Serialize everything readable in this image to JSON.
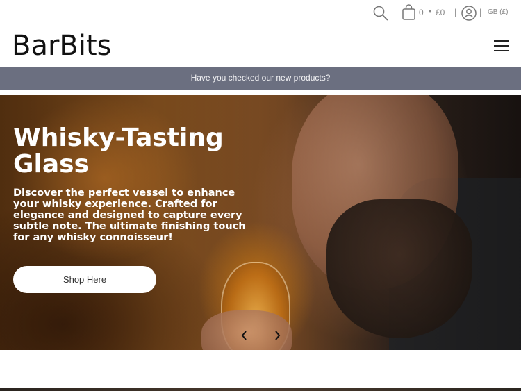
{
  "utility": {
    "cart_count": "0",
    "separator_dot": "•",
    "cart_total": "£0",
    "divider": "|",
    "locale": "GB (£)"
  },
  "header": {
    "logo_text": "BarBits"
  },
  "announcement": {
    "text": "Have you checked our new products?"
  },
  "hero": {
    "title": "Whisky-Tasting Glass",
    "description": "Discover the perfect vessel to enhance your whisky experience. Crafted for elegance and designed to capture every subtle note. The ultimate finishing touch for any whisky connoisseur!",
    "button_label": "Shop Here"
  },
  "icons": {
    "search": "search-icon",
    "cart": "cart-icon",
    "account": "account-icon",
    "menu": "hamburger-menu-icon",
    "prev": "chevron-left-icon",
    "next": "chevron-right-icon"
  }
}
